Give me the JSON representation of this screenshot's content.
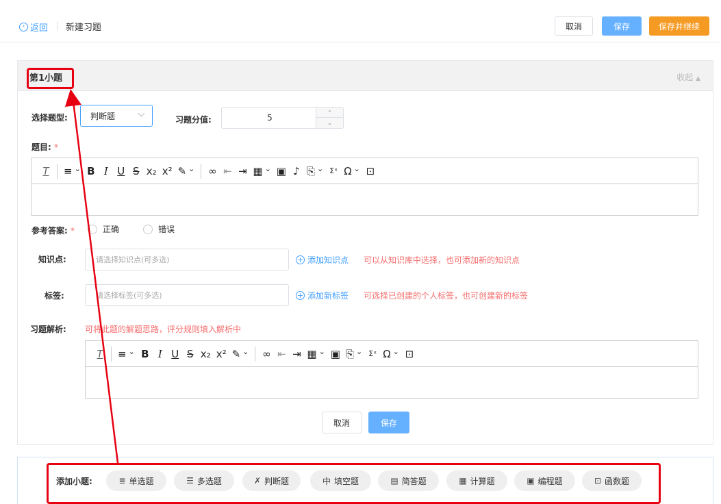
{
  "header": {
    "back_label": "返回",
    "page_title": "新建习题",
    "cancel_label": "取消",
    "save_label": "保存",
    "save_continue_label": "保存并继续"
  },
  "question": {
    "title": "第1小题",
    "collapse_label": "收起",
    "type_label": "选择题型:",
    "type_value": "判断题",
    "score_label": "习题分值:",
    "score_value": "5",
    "stem_label": "题目:",
    "answer_label": "参考答案:",
    "answer_options": [
      "正确",
      "错误"
    ],
    "knowledge_label": "知识点:",
    "knowledge_placeholder": "请选择知识点(可多选)",
    "knowledge_add": "添加知识点",
    "knowledge_hint": "可以从知识库中选择，也可添加新的知识点",
    "tag_label": "标签:",
    "tag_placeholder": "请选择标签(可多选)",
    "tag_add": "添加新标签",
    "tag_hint": "可选择已创建的个人标签，也可创建新的标签",
    "analysis_label": "习题解析:",
    "analysis_hint": "可将此题的解题思路，评分规则填入解析中",
    "cancel_label": "取消",
    "save_label": "保存"
  },
  "toolbar_icons": [
    "clear-format",
    "align",
    "bold",
    "italic",
    "underline",
    "strikethrough",
    "subscript",
    "superscript",
    "highlight",
    "link",
    "outdent",
    "indent",
    "table",
    "image",
    "audio",
    "template",
    "formula",
    "special-char",
    "fullscreen"
  ],
  "add_section": {
    "label": "添加小题:",
    "types": [
      {
        "icon": "≣",
        "label": "单选题"
      },
      {
        "icon": "☰",
        "label": "多选题"
      },
      {
        "icon": "✗",
        "label": "判断题"
      },
      {
        "icon": "中",
        "label": "填空题"
      },
      {
        "icon": "▤",
        "label": "简答题"
      },
      {
        "icon": "▦",
        "label": "计算题"
      },
      {
        "icon": "▣",
        "label": "编程题"
      },
      {
        "icon": "⊡",
        "label": "函数题"
      }
    ]
  },
  "colors": {
    "primary": "#409eff",
    "orange": "#f59a23",
    "danger": "#f56c6c",
    "annotation": "#e60012"
  }
}
